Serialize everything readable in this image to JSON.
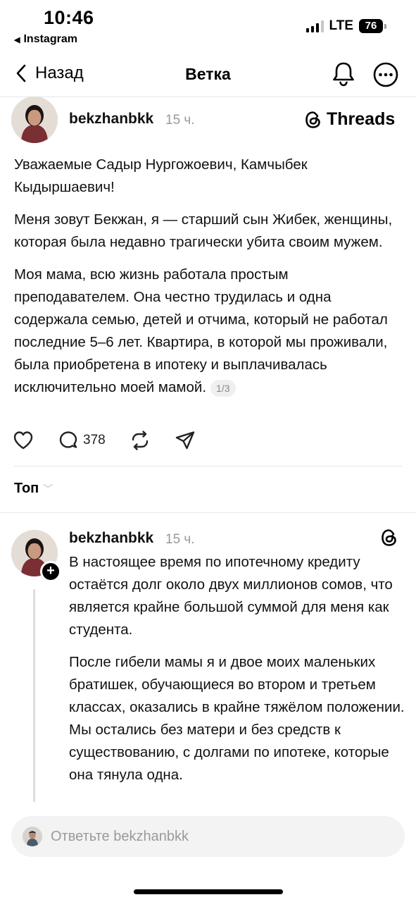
{
  "status_bar": {
    "time": "10:46",
    "back_app": "Instagram",
    "network": "LTE",
    "battery": "76"
  },
  "header": {
    "back_label": "Назад",
    "title": "Ветка"
  },
  "post": {
    "username": "bekzhanbkk",
    "time": "15 ч.",
    "brand": "Threads",
    "paragraphs": [
      "Уважаемые Садыр Нургожоевич, Камчыбек Кыдыршаевич!",
      "Меня зовут Бекжан, я — старший сын Жибек, женщины, которая была недавно трагически убита своим мужем.",
      "Моя мама, всю жизнь работала простым преподавателем. Она честно трудилась и одна содержала семью, детей и отчима, который не работал последние 5–6 лет. Квартира, в которой мы проживали, была приобретена в ипотеку и выплачивалась исключительно моей мамой."
    ],
    "page_badge": "1/3",
    "reply_count": "378"
  },
  "sort": {
    "label": "Топ"
  },
  "reply": {
    "username": "bekzhanbkk",
    "time": "15 ч.",
    "paragraphs": [
      "В настоящее время по ипотечному кредиту остаётся долг около двух миллионов сомов, что является крайне большой суммой для меня как студента.",
      "После гибели мамы я и двое моих маленьких братишек, обучающиеся во втором и третьем классах, оказались в крайне тяжёлом положении. Мы остались без матери и без средств к существованию, с долгами по ипотеке, которые она тянула одна."
    ]
  },
  "reply_bar": {
    "placeholder": "Ответьте bekzhanbkk"
  }
}
